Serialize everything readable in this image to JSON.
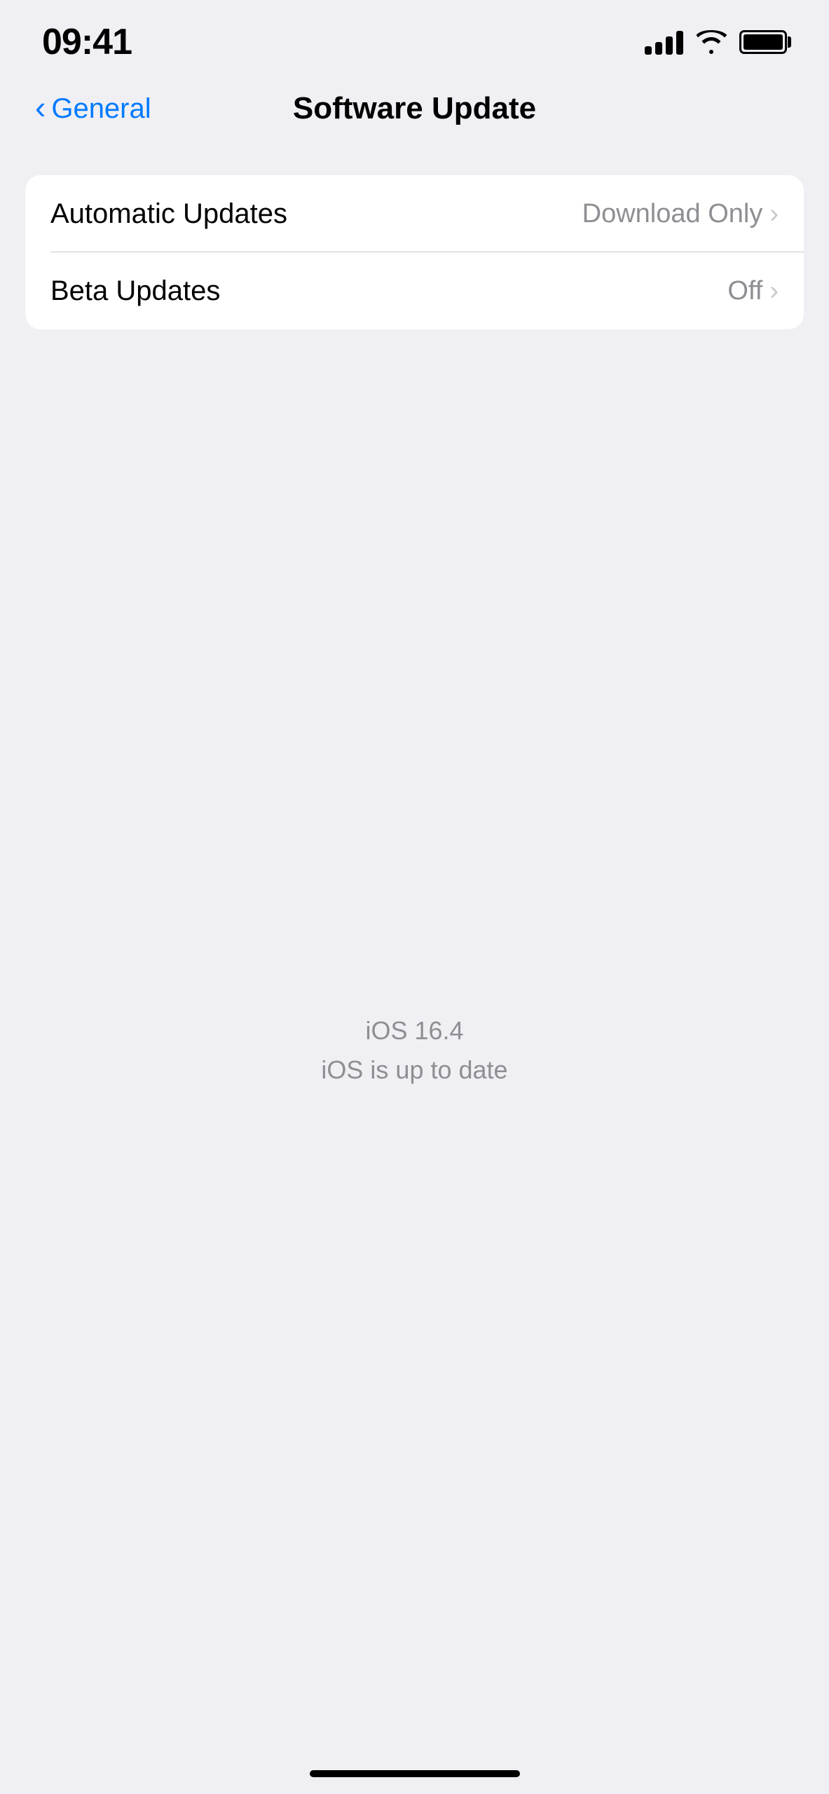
{
  "statusBar": {
    "time": "09:41",
    "signalBars": 4,
    "wifiOn": true,
    "batteryFull": true
  },
  "navigation": {
    "backLabel": "General",
    "title": "Software Update"
  },
  "settings": {
    "rows": [
      {
        "label": "Automatic Updates",
        "value": "Download Only",
        "hasChevron": true
      },
      {
        "label": "Beta Updates",
        "value": "Off",
        "hasChevron": true
      }
    ]
  },
  "centerInfo": {
    "version": "iOS 16.4",
    "status": "iOS is up to date"
  },
  "homeIndicator": true
}
